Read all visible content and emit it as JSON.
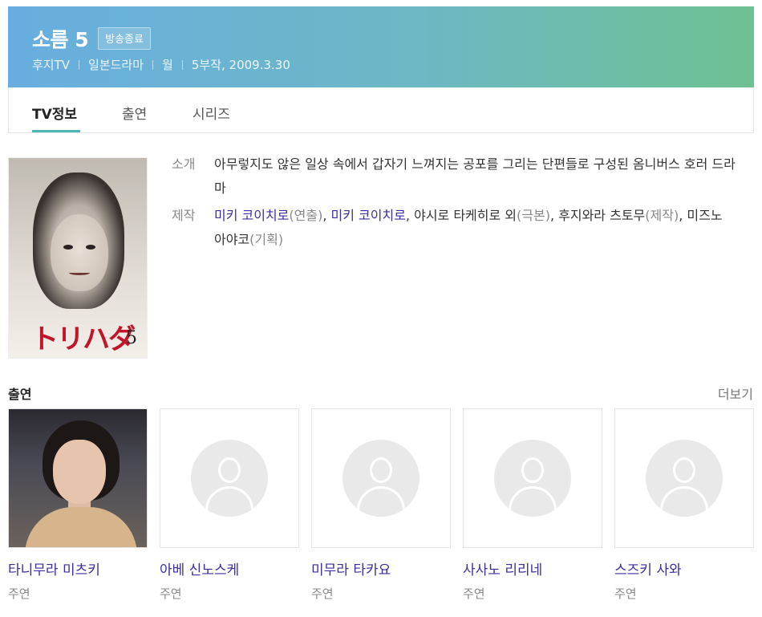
{
  "header": {
    "title": "소름 5",
    "badge": "방송종료",
    "meta": [
      "후지TV",
      "일본드라마",
      "월",
      "5부작, 2009.3.30"
    ],
    "gradient_colors": [
      "#67aee0",
      "#6fc192"
    ]
  },
  "tabs": [
    {
      "label": "TV정보",
      "active": true
    },
    {
      "label": "출연",
      "active": false
    },
    {
      "label": "시리즈",
      "active": false
    }
  ],
  "poster": {
    "title_text": "トリハダ",
    "number": "5"
  },
  "info": {
    "intro_label": "소개",
    "intro_text": "아무렇지도 않은 일상 속에서 갑자기 느껴지는 공포를 그리는 단편들로 구성된 옴니버스 호러 드라마",
    "production_label": "제작",
    "production": {
      "director_name": "미키 코이치로",
      "director_role": "(연출)",
      "sep1": ", ",
      "writer1": "미키 코이치로",
      "writer_rest": ", 야시로 타케히로 외",
      "writer_role": "(극본)",
      "sep2": ", ",
      "producer_name": "후지와라 츠토무",
      "producer_role": "(제작)",
      "sep3": ", ",
      "planner_name": "미즈노 아야코",
      "planner_role": "(기획)"
    }
  },
  "cast": {
    "heading": "출연",
    "more_label": "더보기",
    "members": [
      {
        "name": "타니무라 미츠키",
        "role": "주연",
        "has_photo": true
      },
      {
        "name": "아베 신노스케",
        "role": "주연",
        "has_photo": false
      },
      {
        "name": "미무라 타카요",
        "role": "주연",
        "has_photo": false
      },
      {
        "name": "사사노 리리네",
        "role": "주연",
        "has_photo": false
      },
      {
        "name": "스즈키 사와",
        "role": "주연",
        "has_photo": false
      }
    ]
  },
  "colors": {
    "link": "#3a2fa0",
    "tab_accent": "#4fb6b8"
  }
}
